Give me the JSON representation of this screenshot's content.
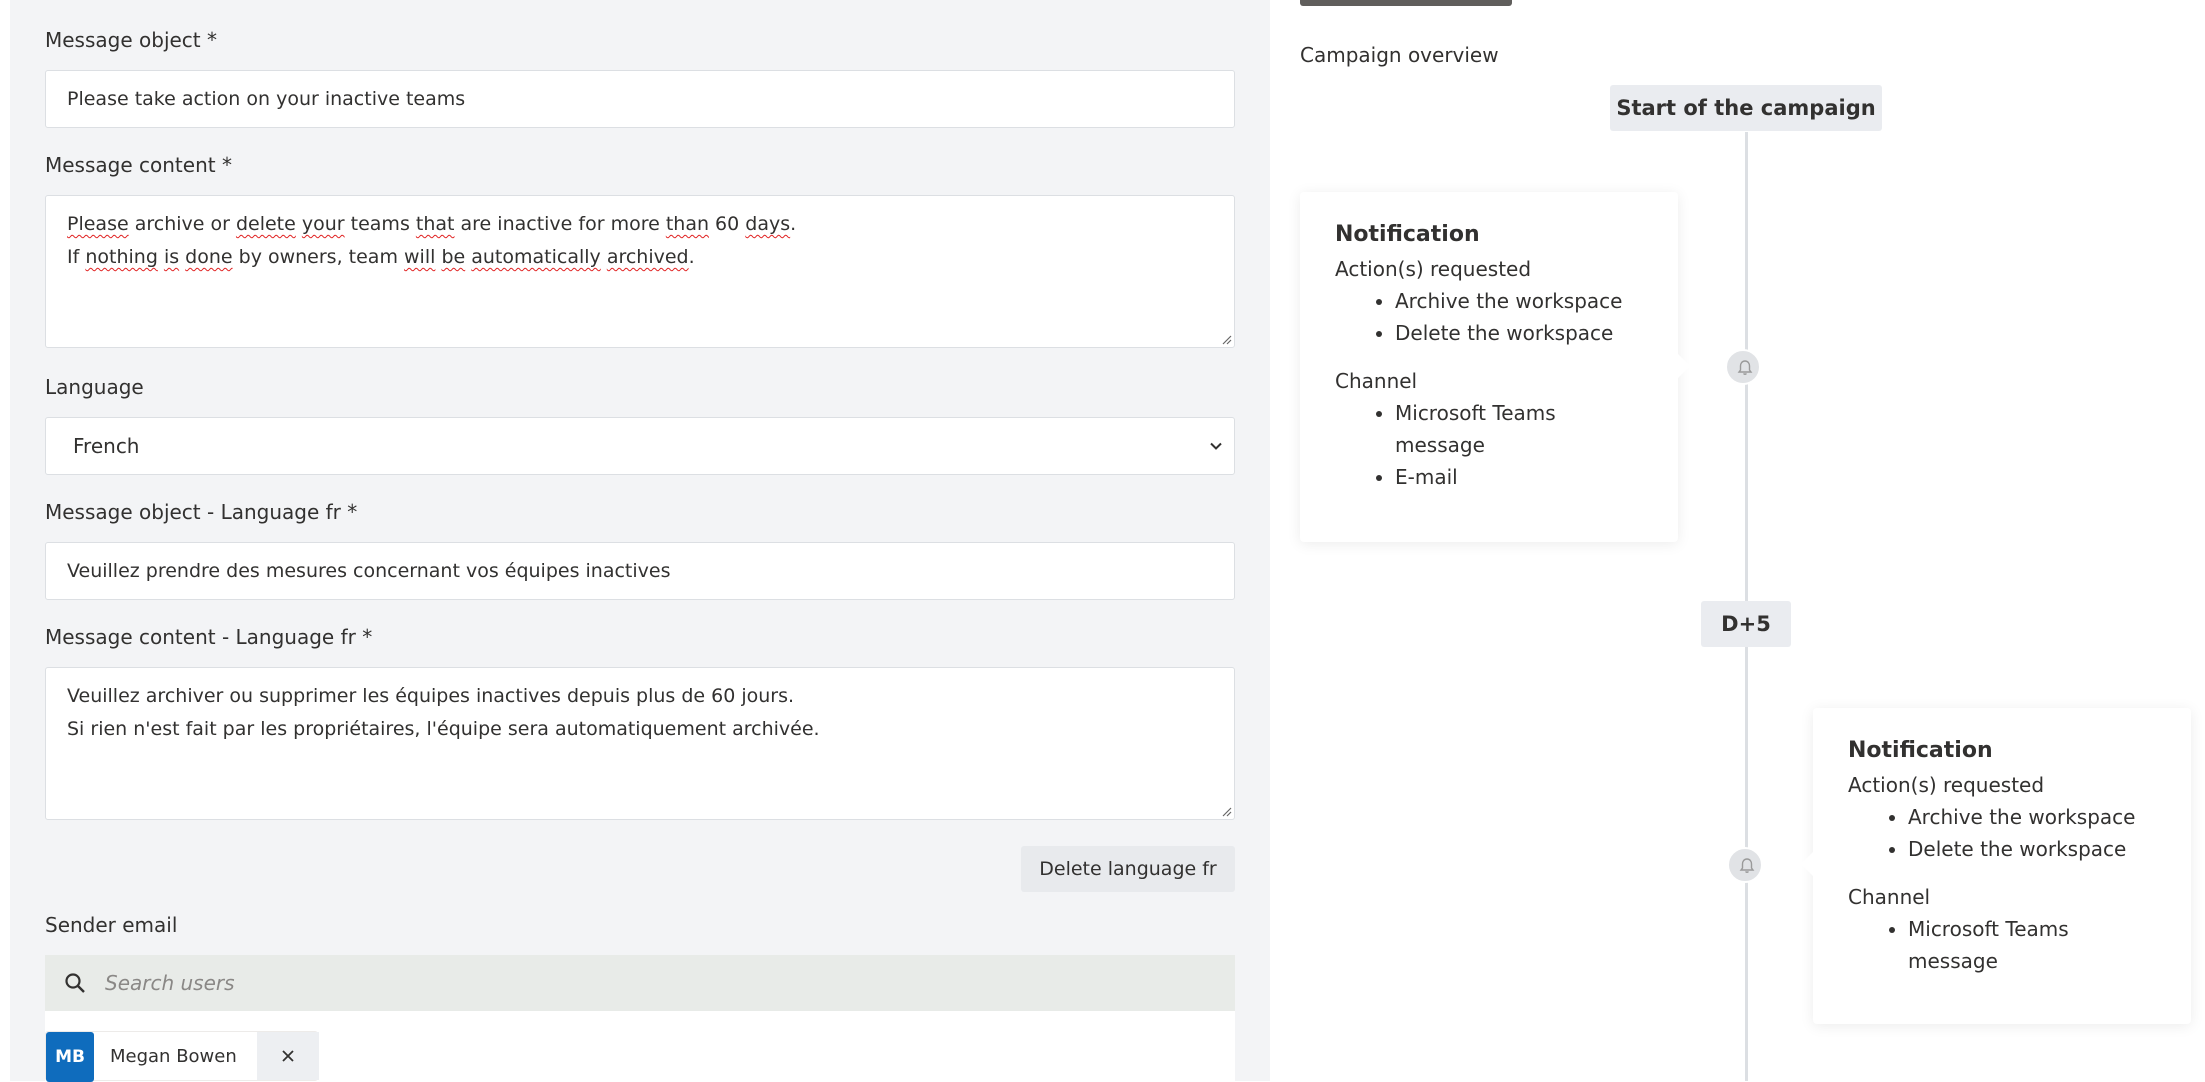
{
  "form": {
    "message_object_label": "Message object *",
    "message_object_value": "Please take action on your inactive teams",
    "message_content_label": "Message content *",
    "message_content_lines": [
      "Please archive or delete your teams that are inactive for more than 60 days.",
      "If nothing is done by owners, team will be automatically archived."
    ],
    "language_label": "Language",
    "language_value": "French",
    "message_object_fr_label": "Message object - Language fr *",
    "message_object_fr_value": "Veuillez prendre des mesures concernant vos équipes inactives",
    "message_content_fr_label": "Message content - Language fr *",
    "message_content_fr_lines": [
      "Veuillez archiver ou supprimer les équipes inactives depuis plus de 60 jours.",
      "Si rien n'est fait par les propriétaires, l'équipe sera automatiquement archivée."
    ],
    "delete_language_button": "Delete language fr",
    "sender_email_label": "Sender email",
    "search_placeholder": "Search users",
    "selected_user": {
      "initials": "MB",
      "name": "Megan Bowen"
    }
  },
  "overview": {
    "title": "Campaign overview",
    "milestones": [
      "Start of the campaign",
      "D+5"
    ],
    "cards": [
      {
        "title": "Notification",
        "actions_label": "Action(s) requested",
        "actions": [
          "Archive the workspace",
          "Delete the workspace"
        ],
        "channel_label": "Channel",
        "channels": [
          "Microsoft Teams message",
          "E-mail"
        ]
      },
      {
        "title": "Notification",
        "actions_label": "Action(s) requested",
        "actions": [
          "Archive the workspace",
          "Delete the workspace"
        ],
        "channel_label": "Channel",
        "channels": [
          "Microsoft Teams message"
        ]
      }
    ]
  },
  "icons": {
    "search": "search-icon",
    "chevron": "chevron-down-icon",
    "close": "close-icon",
    "bell": "bell-icon"
  },
  "colors": {
    "avatar_bg": "#0f6cbd",
    "panel_bg": "#f3f4f6",
    "spellcheck": "#e02020"
  }
}
